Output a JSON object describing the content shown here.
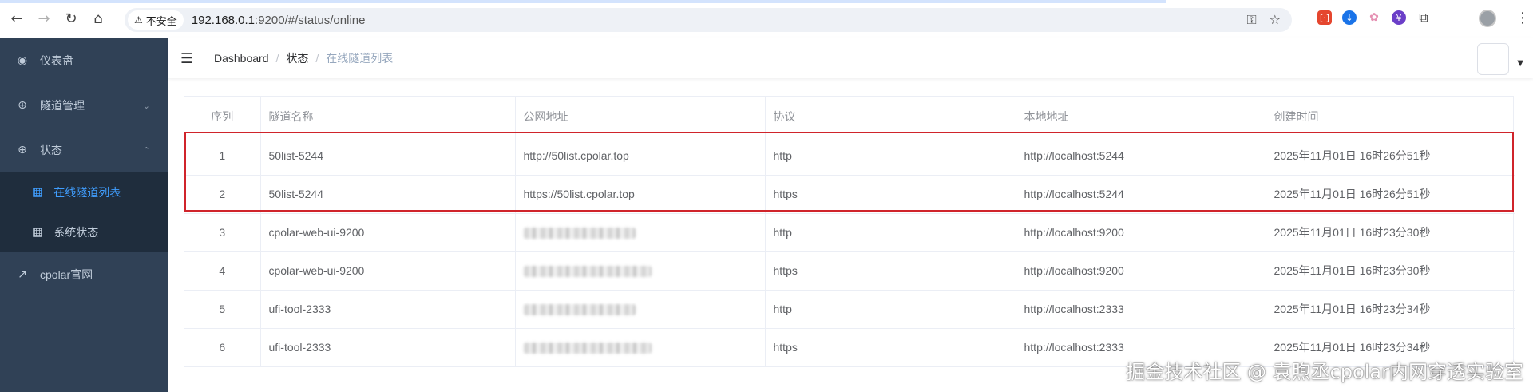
{
  "browser": {
    "security_label": "不安全",
    "url_host": "192.168.0.1",
    "url_rest": ":9200/#/status/online",
    "icons": [
      "back-icon",
      "forward-icon",
      "reload-icon",
      "home-icon",
      "key-icon",
      "star-icon",
      "extensions-icon",
      "profile-icon",
      "more-icon"
    ]
  },
  "sidebar": {
    "items": [
      {
        "label": "仪表盘",
        "icon": "dashboard-icon"
      },
      {
        "label": "隧道管理",
        "icon": "plus-circle-icon",
        "expanded": false
      },
      {
        "label": "状态",
        "icon": "plus-circle-icon",
        "expanded": true,
        "children": [
          {
            "label": "在线隧道列表",
            "icon": "grid-icon",
            "active": true
          },
          {
            "label": "系统状态",
            "icon": "grid-icon",
            "active": false
          }
        ]
      },
      {
        "label": "cpolar官网",
        "icon": "external-link-icon"
      }
    ],
    "colors": {
      "bg": "#304156",
      "sub_bg": "#1f2d3d",
      "active": "#409eff"
    }
  },
  "breadcrumb": [
    "Dashboard",
    "状态",
    "在线隧道列表"
  ],
  "table": {
    "headers": [
      "序列",
      "隧道名称",
      "公网地址",
      "协议",
      "本地地址",
      "创建时间"
    ],
    "rows": [
      {
        "index": "1",
        "name": "50list-5244",
        "public_url": "http://50list.cpolar.top",
        "protocol": "http",
        "local": "http://localhost:5244",
        "created": "2025年11月01日 16时26分51秒",
        "blurred": false
      },
      {
        "index": "2",
        "name": "50list-5244",
        "public_url": "https://50list.cpolar.top",
        "protocol": "https",
        "local": "http://localhost:5244",
        "created": "2025年11月01日 16时26分51秒",
        "blurred": false
      },
      {
        "index": "3",
        "name": "cpolar-web-ui-9200",
        "public_url": "",
        "protocol": "http",
        "local": "http://localhost:9200",
        "created": "2025年11月01日 16时23分30秒",
        "blurred": true
      },
      {
        "index": "4",
        "name": "cpolar-web-ui-9200",
        "public_url": "",
        "protocol": "https",
        "local": "http://localhost:9200",
        "created": "2025年11月01日 16时23分30秒",
        "blurred": true
      },
      {
        "index": "5",
        "name": "ufi-tool-2333",
        "public_url": "",
        "protocol": "http",
        "local": "http://localhost:2333",
        "created": "2025年11月01日 16时23分34秒",
        "blurred": true
      },
      {
        "index": "6",
        "name": "ufi-tool-2333",
        "public_url": "",
        "protocol": "https",
        "local": "http://localhost:2333",
        "created": "2025年11月01日 16时23分34秒",
        "blurred": true
      }
    ]
  },
  "highlight_color": "#d0242b",
  "watermark": "掘金技术社区 @ 袁煦丞cpolar内网穿透实验室"
}
